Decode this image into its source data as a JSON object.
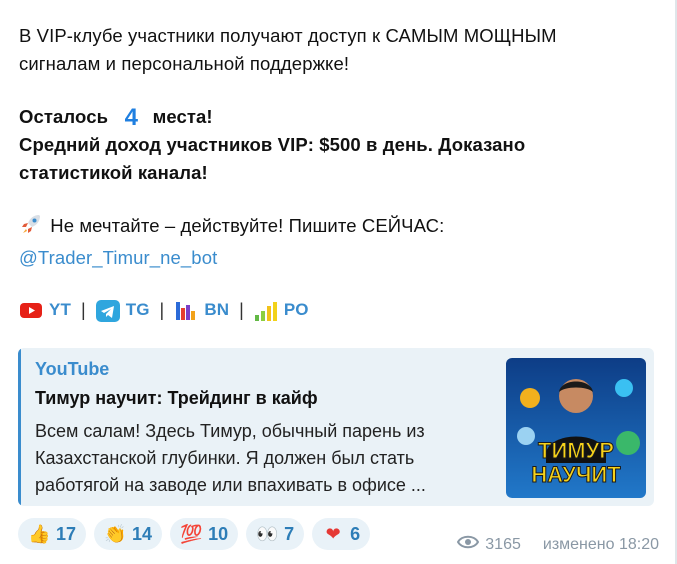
{
  "message": {
    "line1": "В VIP-клубе участники получают доступ к САМЫМ МОЩНЫМ",
    "line2": "сигналам и персональной поддержке!",
    "remaining_prefix": "Осталось",
    "remaining_number": "4",
    "remaining_suffix": "места!",
    "income_line1": " Средний доход участников VIP: $500 в день. Доказано",
    "income_line2": "статистикой канала!",
    "cta_text": "Не мечтайте – действуйте! Пишите СЕЙЧАС:",
    "cta_link": "@Trader_Timur_ne_bot"
  },
  "social_links": [
    {
      "label": "YT",
      "icon": "youtube-icon"
    },
    {
      "label": "TG",
      "icon": "telegram-icon"
    },
    {
      "label": "BN",
      "icon": "bar-chart-icon"
    },
    {
      "label": "PO",
      "icon": "signal-bars-icon"
    }
  ],
  "separator": "|",
  "preview": {
    "site": "YouTube",
    "title": "Тимур научит: Трейдинг в кайф",
    "description_line1": "Всем салам! Здесь Тимур, обычный парень из",
    "description_line2": "Казахстанской глубинки. Я должен был стать",
    "description_line3": "работягой на заводе или впахивать в офисе ...",
    "thumb_text_line1": "ТИМУР",
    "thumb_text_line2": "НАУЧИТ"
  },
  "reactions": [
    {
      "emoji": "👍",
      "count": "17"
    },
    {
      "emoji": "👏",
      "count": "14"
    },
    {
      "emoji": "💯",
      "count": "10"
    },
    {
      "emoji": "👀",
      "count": "7"
    },
    {
      "emoji": "❤",
      "count": "6"
    }
  ],
  "meta": {
    "views": "3165",
    "edited": "изменено 18:20"
  },
  "colors": {
    "link": "#3a8ccd",
    "preview_bg": "#eaf2f7",
    "reaction_bg": "#e9f2f8",
    "meta": "#8a98a5"
  }
}
